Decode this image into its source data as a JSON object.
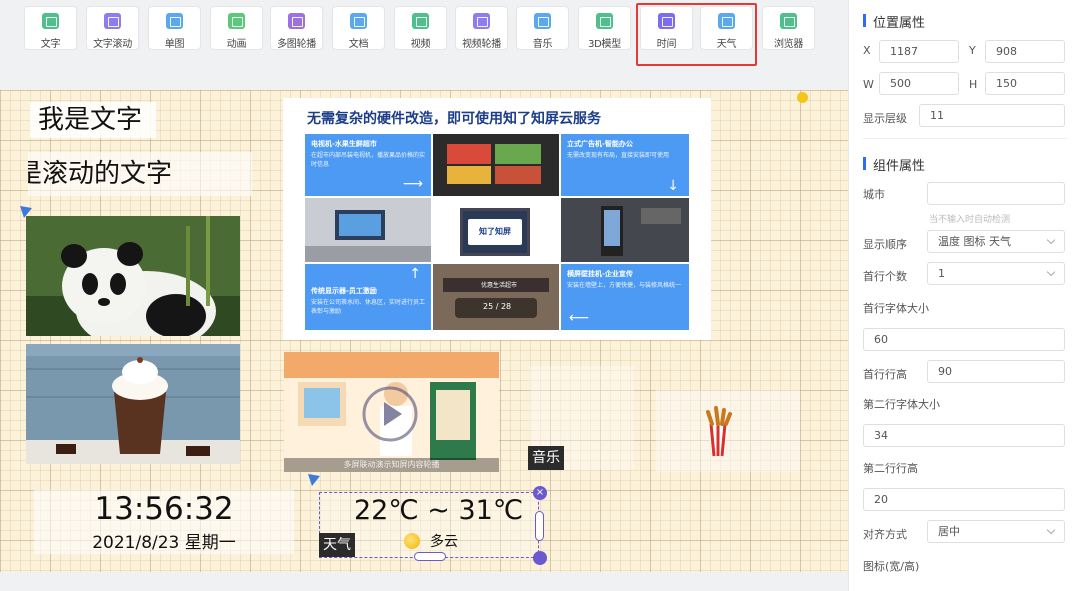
{
  "toolbar": {
    "tools": [
      {
        "label": "文字",
        "color": "#4fc08d"
      },
      {
        "label": "文字滚动",
        "color": "#8e7cf0"
      },
      {
        "label": "单图",
        "color": "#5aa9f0"
      },
      {
        "label": "动画",
        "color": "#5cc879"
      },
      {
        "label": "多图轮播",
        "color": "#9b72e0"
      },
      {
        "label": "文档",
        "color": "#5aa9f0"
      },
      {
        "label": "视频",
        "color": "#4fc08d"
      },
      {
        "label": "视频轮播",
        "color": "#8e7cf0"
      },
      {
        "label": "音乐",
        "color": "#5aa9f0"
      },
      {
        "label": "3D模型",
        "color": "#4fc08d"
      },
      {
        "label": "时间",
        "color": "#7b6cf0"
      },
      {
        "label": "天气",
        "color": "#5aa9f0"
      },
      {
        "label": "浏览器",
        "color": "#4fc08d"
      }
    ]
  },
  "canvas": {
    "static_text": "我是文字",
    "scroll_text": "是滚动的文字",
    "clock": {
      "time": "13:56:32",
      "date": "2021/8/23  星期一"
    },
    "banner": {
      "title": "无需复杂的硬件改造，即可使用知了知屏云服务",
      "center_logo": "知了知屏",
      "cells": [
        {
          "heading": "电视机-水果生鲜超市",
          "desc": "在超市内部吊装电视机，播放果品价格的实时信息"
        },
        {
          "heading": "立式广告机-智能办公",
          "desc": "无需改变现有布局，直接安装即可使用"
        },
        {
          "heading": "传统显示器-员工激励",
          "desc": "安装在公司茶水间、休息区，实时进行员工表彰与激励"
        },
        {
          "heading": "横屏壁挂机-企业宣传",
          "desc": "安装在墙壁上，方便快捷，与装修风格统一"
        }
      ],
      "photo_counter": "25 / 28",
      "photo_banner": "优惠生活超市"
    },
    "video_caption": "多屏联动演示知屏内容轮播",
    "music_label": "音乐",
    "weather": {
      "temp": "22℃ ~ 31℃",
      "desc": "多云",
      "tag": "天气",
      "close": "×"
    }
  },
  "panel": {
    "position_title": "位置属性",
    "x_label": "X",
    "x_value": "1187",
    "y_label": "Y",
    "y_value": "908",
    "w_label": "W",
    "w_value": "500",
    "h_label": "H",
    "h_value": "150",
    "layer_label": "显示层级",
    "layer_value": "11",
    "component_title": "组件属性",
    "city_label": "城市",
    "city_value": "",
    "city_hint": "当不输入时自动检测",
    "order_label": "显示顺序",
    "order_value": "温度 图标 天气",
    "first_count_label": "首行个数",
    "first_count_value": "1",
    "first_font_label": "首行字体大小",
    "first_font_value": "60",
    "first_height_label": "首行行高",
    "first_height_value": "90",
    "second_font_label": "第二行字体大小",
    "second_font_value": "34",
    "second_height_label": "第二行行高",
    "second_height_value": "20",
    "align_label": "对齐方式",
    "align_value": "居中",
    "icon_size_label": "图标(宽/高)"
  }
}
